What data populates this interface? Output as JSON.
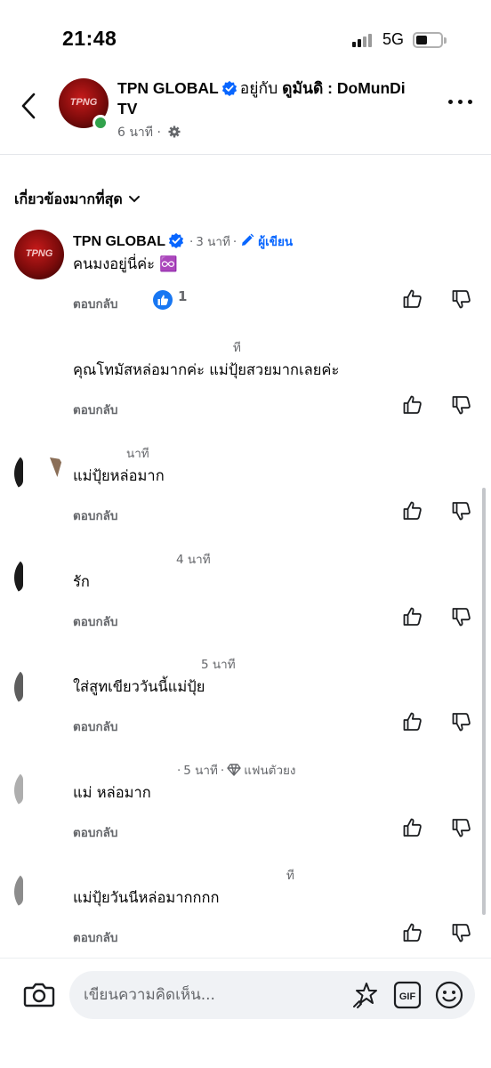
{
  "status_bar": {
    "time": "21:48",
    "network": "5G"
  },
  "header": {
    "page_name": "TPN GLOBAL",
    "with_text": "อยู่กับ",
    "tagged": "ดูมันดิ : DoMunDi TV",
    "time": "6 นาที",
    "avatar_logo": "TPNG"
  },
  "filter": {
    "label": "เกี่ยวข้องมากที่สุด"
  },
  "comments": [
    {
      "author": "TPN GLOBAL",
      "time": "3 นาที",
      "badge": "ผู้เขียน",
      "text": "คนมงอยู่นี่ค่ะ ♾️",
      "reply": "ตอบกลับ",
      "reaction_count": "1"
    },
    {
      "author": "",
      "time": "ที",
      "text": "คุณโทมัสหล่อมากค่ะ แม่ปุ้ยสวยมากเลยค่ะ",
      "reply": "ตอบกลับ"
    },
    {
      "author": "",
      "time": "นาที",
      "text": "แม่ปุ้ยหล่อมาก",
      "reply": "ตอบกลับ"
    },
    {
      "author": "",
      "time": "4 นาที",
      "text": "รัก",
      "reply": "ตอบกลับ"
    },
    {
      "author": "",
      "time": "5 นาที",
      "text": "ใส่สูทเขียววันนี้แม่ปุ้ย",
      "reply": "ตอบกลับ"
    },
    {
      "author": "",
      "time": "5 นาที",
      "badge": "แฟนตัวยง",
      "text": "แม่ หล่อมาก",
      "reply": "ตอบกลับ"
    },
    {
      "author": "",
      "time": "ที",
      "text": "แม่ปุ้ยวันนีหล่อมากกกก",
      "reply": "ตอบกลับ"
    }
  ],
  "composer": {
    "placeholder": "เขียนความคิดเห็น...",
    "gif_label": "GIF"
  },
  "colors": {
    "brand_blue": "#0866ff",
    "like_blue": "#1877f2",
    "online_green": "#31a24c",
    "muted": "#65676b"
  }
}
